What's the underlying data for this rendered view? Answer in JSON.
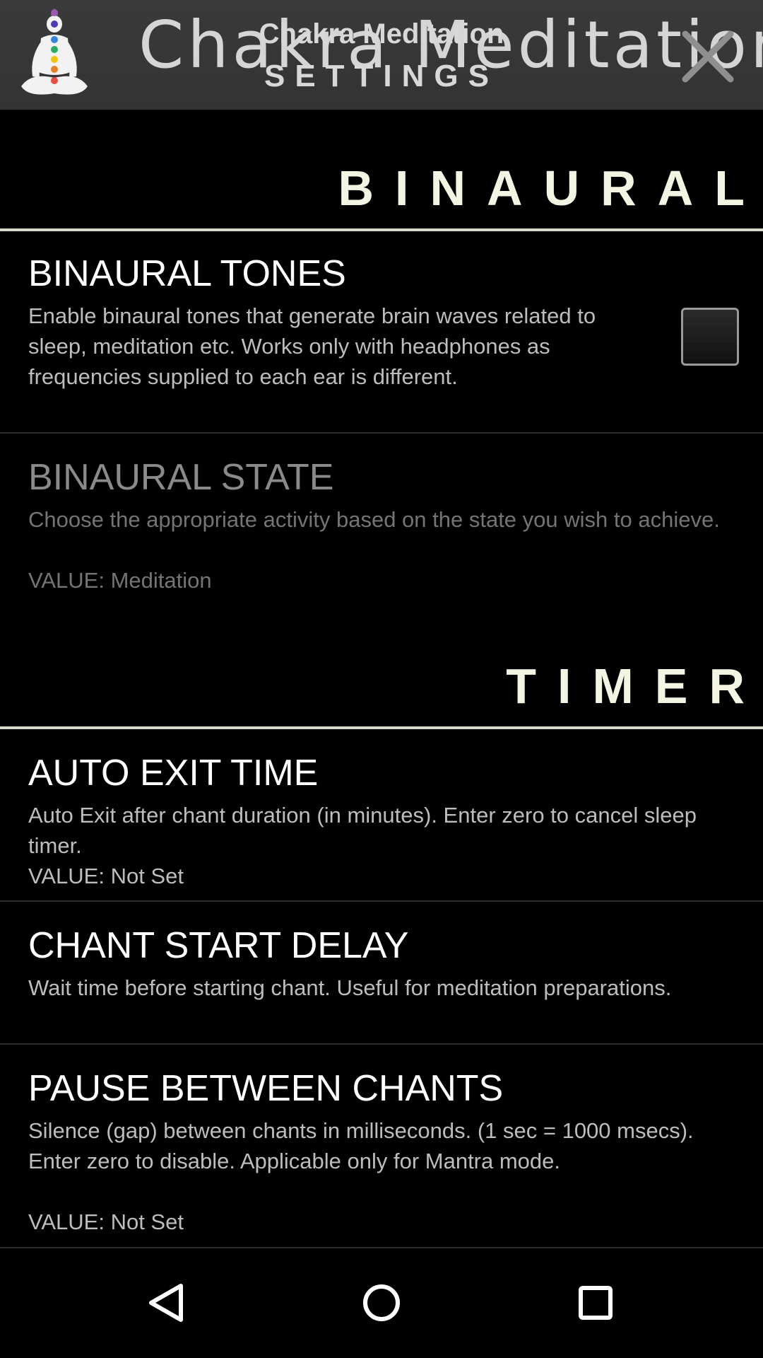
{
  "header": {
    "app_name": "Chakra Meditation",
    "screen_title": "SETTINGS",
    "logo_text": "Chakra Meditation?"
  },
  "icons": {
    "app_logo": "meditating-figure-chakra-icon",
    "close": "close-icon",
    "nav_back": "triangle-back-icon",
    "nav_home": "circle-home-icon",
    "nav_recents": "square-recents-icon"
  },
  "colors": {
    "header_bg": "#353535",
    "background": "#000000",
    "category_text": "#f4f4e3",
    "divider": "#d9d9c8"
  },
  "sections": {
    "binaural": {
      "title": "BINAURAL",
      "binaural_tones": {
        "title": "BINAURAL TONES",
        "summary": "Enable binaural tones that generate brain waves related to sleep, meditation etc. Works only with headphones as frequencies supplied to each ear is different.",
        "checked": false
      },
      "binaural_state": {
        "title": "BINAURAL STATE",
        "summary": "Choose the appropriate activity based on the state you wish to achieve.",
        "value": "VALUE: Meditation",
        "enabled": false
      }
    },
    "timer": {
      "title": "TIMER",
      "auto_exit_time": {
        "title": "AUTO EXIT TIME",
        "summary": "Auto Exit after chant duration (in minutes). Enter zero to cancel sleep timer.",
        "value": "VALUE: Not Set"
      },
      "chant_start_delay": {
        "title": "CHANT START DELAY",
        "summary": "Wait time before starting chant. Useful for meditation preparations."
      },
      "pause_between_chants": {
        "title": "PAUSE BETWEEN CHANTS",
        "summary": "Silence (gap) between chants in milliseconds. (1 sec = 1000 msecs). Enter zero to disable. Applicable only for Mantra mode.",
        "value": "VALUE: Not Set"
      }
    }
  }
}
